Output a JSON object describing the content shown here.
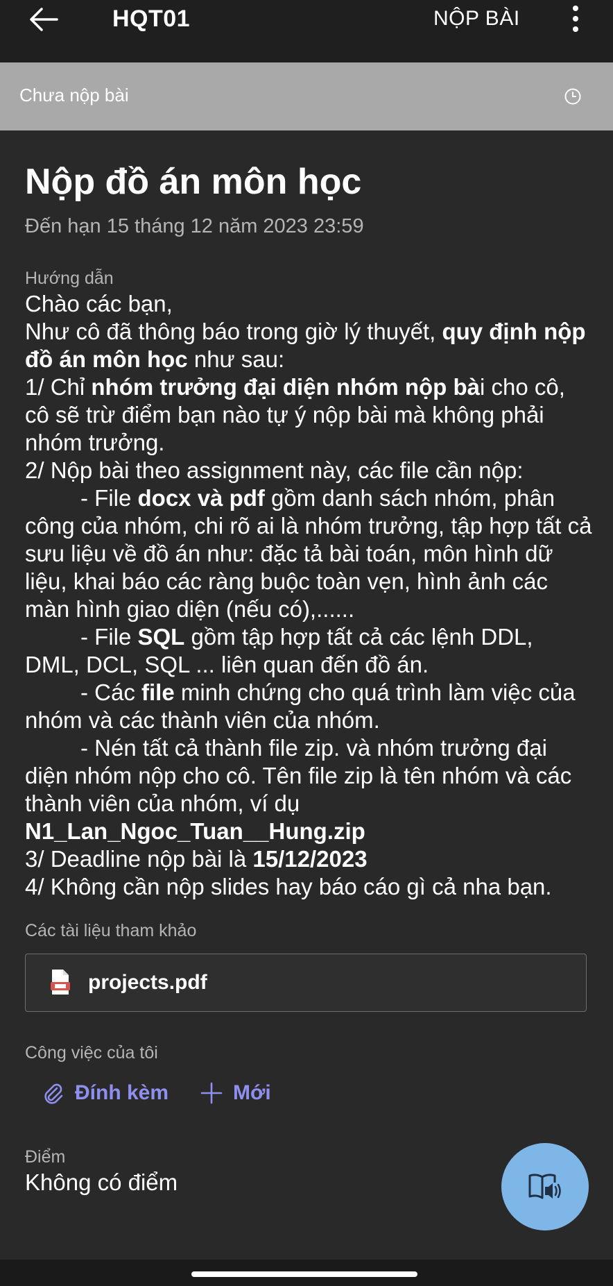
{
  "header": {
    "title": "HQT01",
    "submit_label": "NỘP BÀI",
    "back_icon": "arrow-left-icon",
    "more_icon": "more-vertical-icon"
  },
  "status": {
    "text": "Chưa nộp bài",
    "icon": "clock-icon"
  },
  "assignment": {
    "title": "Nộp đồ án môn học",
    "due": "Đến hạn 15 tháng 12 năm 2023 23:59"
  },
  "instructions": {
    "label": "Hướng dẫn",
    "greeting": "Chào các bạn,",
    "intro_1": "Như cô đã thông báo trong giờ lý thuyết, ",
    "intro_bold": "quy định nộp đồ án môn học",
    "intro_2": " như sau:",
    "r1_pre": "1/ Chỉ ",
    "r1_bold": "nhóm trưởng đại diện nhóm nộp bà",
    "r1_post": "i cho cô, cô sẽ trừ điểm bạn nào tự ý nộp bài mà không phải nhóm trưởng.",
    "r2": "2/ Nộp bài theo assignment này, các file cần nộp:",
    "f1_pre": "- File ",
    "f1_bold": "docx và pdf",
    "f1_post": " gồm danh sách nhóm, phân công của nhóm, chi rõ ai là nhóm trưởng, tập hợp tất cả sưu liệu về đồ án như: đặc tả bài toán, môn hình dữ liệu, khai báo các ràng buộc toàn vẹn, hình ảnh các màn hình giao diện (nếu có),......",
    "f2_pre": "- File ",
    "f2_bold": "SQL",
    "f2_post": " gồm tập hợp tất cả các lệnh DDL, DML, DCL, SQL ... liên quan đến đồ án.",
    "f3_pre": "- Các ",
    "f3_bold": "file",
    "f3_post": " minh chứng cho quá trình làm việc của nhóm và các thành viên của nhóm.",
    "f4": "- Nén tất cả thành file zip. và nhóm trưởng đại diện nhóm nộp cho cô. Tên file zip là tên nhóm và các thành viên của nhóm, ví dụ",
    "zip_example": "N1_Lan_Ngoc_Tuan__Hung.zip",
    "r3_pre": "3/ Deadline nộp bài là ",
    "r3_bold": "15/12/2023",
    "r4": "4/ Không cần nộp slides hay báo cáo gì cả nha bạn."
  },
  "references": {
    "label": "Các tài liệu tham khảo",
    "file_name": "projects.pdf",
    "file_icon": "pdf-file-icon"
  },
  "my_work": {
    "label": "Công việc của tôi",
    "attach_label": "Đính kèm",
    "new_label": "Mới",
    "attach_icon": "paperclip-icon",
    "new_icon": "plus-icon"
  },
  "grade": {
    "label": "Điểm",
    "value": "Không có điểm"
  },
  "fab": {
    "icon": "immersive-reader-icon",
    "color": "#7fb6e8"
  },
  "colors": {
    "background": "#292929",
    "accent": "#8f8ff0",
    "status_bar": "#a9a9a9"
  }
}
